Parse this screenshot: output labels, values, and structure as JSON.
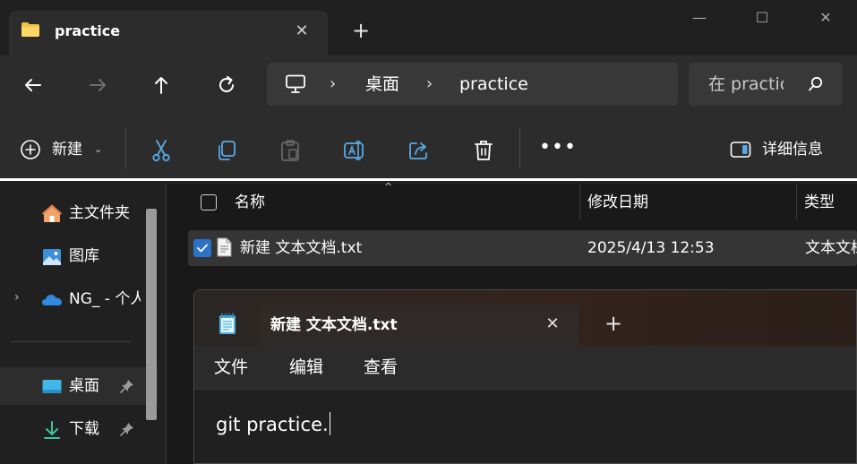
{
  "explorer": {
    "tab": {
      "title": "practice",
      "close_glyph": "✕",
      "icon": "folder-icon"
    },
    "new_tab_glyph": "+",
    "window_controls": {
      "minimize": "—",
      "maximize": "☐",
      "close": "✕"
    },
    "nav": {
      "back": "back-arrow-icon",
      "forward": "forward-arrow-icon",
      "up": "up-arrow-icon",
      "refresh": "refresh-icon"
    },
    "address": {
      "root_icon": "computer-icon",
      "separator": "›",
      "crumbs": [
        "桌面",
        "practice"
      ]
    },
    "search": {
      "placeholder": "在 practice 中搜索"
    },
    "command_bar": {
      "new_label": "新建",
      "new_caret": "⌄",
      "actions": [
        "cut-icon",
        "copy-icon",
        "paste-icon",
        "rename-icon",
        "share-icon",
        "delete-icon"
      ],
      "more": "•••",
      "details_label": "详细信息"
    },
    "sidebar": {
      "items": [
        {
          "label": "主文件夹",
          "icon": "home-icon"
        },
        {
          "label": "图库",
          "icon": "gallery-icon"
        },
        {
          "label": "NG_ - 个人",
          "icon": "onedrive-icon",
          "expand": "›"
        },
        {
          "label": "桌面",
          "icon": "desktop-icon",
          "pinned": true
        },
        {
          "label": "下载",
          "icon": "download-icon",
          "pinned": true
        }
      ]
    },
    "file_list": {
      "columns": [
        "名称",
        "修改日期",
        "类型"
      ],
      "sort_glyph": "^",
      "rows": [
        {
          "name": "新建 文本文档.txt",
          "modified": "2025/4/13 12:53",
          "type": "文本文档",
          "selected": true,
          "check": "✓"
        }
      ]
    }
  },
  "notepad": {
    "app_icon": "notepad-icon",
    "tab_title": "新建 文本文档.txt",
    "tab_close": "✕",
    "new_tab": "+",
    "menu": [
      "文件",
      "编辑",
      "查看"
    ],
    "content": "git practice."
  },
  "colors": {
    "background": "#202020",
    "toolbar": "#2c2c2c",
    "accent": "#2a73c9",
    "folder_yellow": "#f5c242"
  }
}
